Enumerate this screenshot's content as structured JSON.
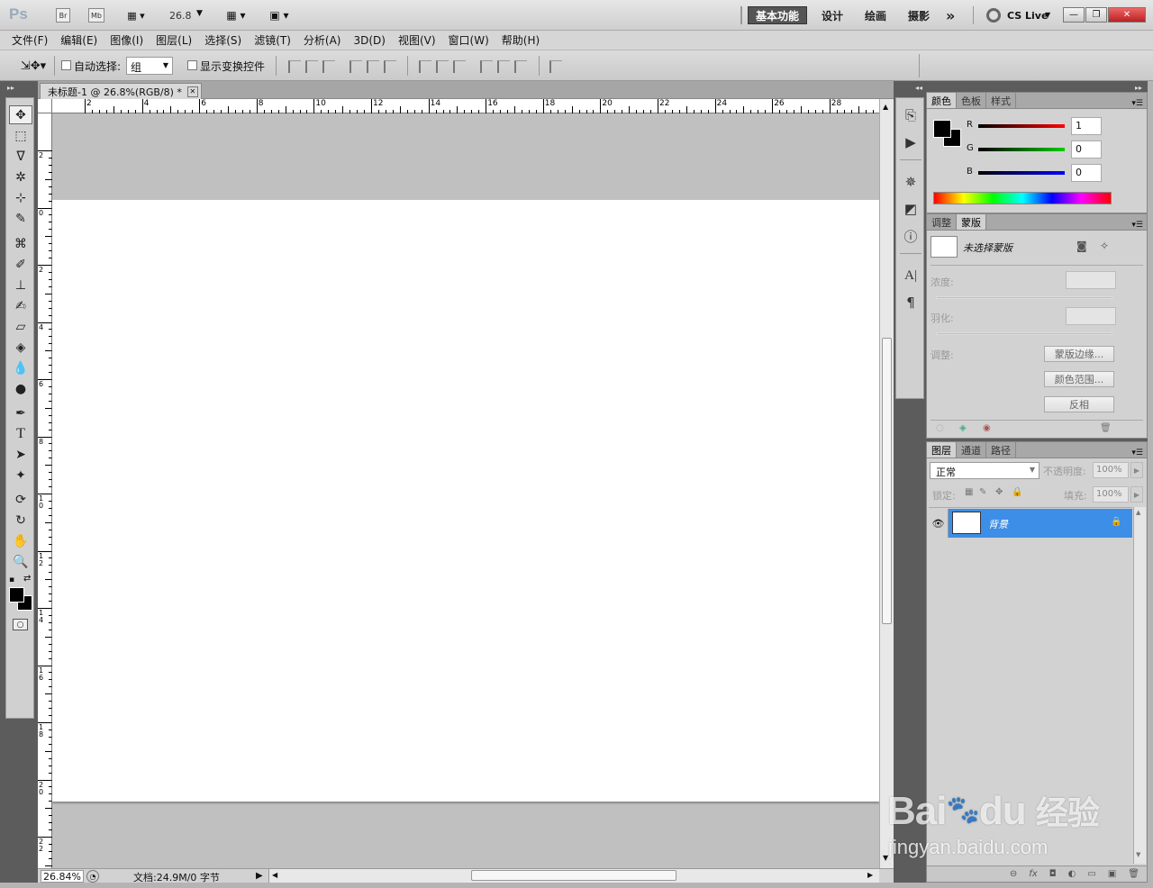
{
  "app": {
    "logo": "Ps",
    "bridge_label": "Br",
    "minibridge_label": "Mb",
    "zoom_value": "26.8",
    "workspaces": [
      "基本功能",
      "设计",
      "绘画",
      "摄影"
    ],
    "more": "»",
    "cs_live": "CS Live",
    "win_controls": [
      "—",
      "❐",
      "✕"
    ]
  },
  "menu": [
    "文件(F)",
    "编辑(E)",
    "图像(I)",
    "图层(L)",
    "选择(S)",
    "滤镜(T)",
    "分析(A)",
    "3D(D)",
    "视图(V)",
    "窗口(W)",
    "帮助(H)"
  ],
  "options": {
    "auto_select_label": "自动选择:",
    "auto_select_value": "组",
    "show_transform_label": "显示变换控件"
  },
  "document": {
    "tab_title": "未标题-1 @ 26.8%(RGB/8) *",
    "tab_close": "✕",
    "ruler_h_labels": [
      "2",
      "4",
      "6",
      "8",
      "10",
      "12",
      "14",
      "16",
      "18",
      "20",
      "22",
      "24",
      "26",
      "28"
    ],
    "ruler_v_labels": [
      "2",
      "0",
      "2",
      "4",
      "6",
      "8",
      "1\n0",
      "1\n2",
      "1\n4",
      "1\n6",
      "1\n8",
      "2\n0",
      "2\n2"
    ],
    "status_zoom": "26.84%",
    "status_doc": "文档:24.9M/0 字节"
  },
  "color_panel": {
    "tabs": [
      "颜色",
      "色板",
      "样式"
    ],
    "channels": [
      {
        "label": "R",
        "value": "1",
        "color": "#cc0000"
      },
      {
        "label": "G",
        "value": "0",
        "color": "#00aa00"
      },
      {
        "label": "B",
        "value": "0",
        "color": "#0000cc"
      }
    ]
  },
  "masks_panel": {
    "tabs": [
      "调整",
      "蒙版"
    ],
    "no_mask": "未选择蒙版",
    "density_label": "浓度:",
    "feather_label": "羽化:",
    "refine_label": "调整:",
    "buttons": [
      "蒙版边缘...",
      "颜色范围...",
      "反相"
    ]
  },
  "layers_panel": {
    "tabs": [
      "图层",
      "通道",
      "路径"
    ],
    "blend_mode": "正常",
    "opacity_label": "不透明度:",
    "opacity_value": "100%",
    "lock_label": "锁定:",
    "fill_label": "填充:",
    "fill_value": "100%",
    "layer_name": "背景",
    "footer_icons": [
      "⊖",
      "fx",
      "◘",
      "◐",
      "▭",
      "▣",
      "🗑"
    ]
  },
  "watermark": {
    "brand": "Bai",
    "brand2": "du",
    "cn": "经验",
    "url": "jingyan.baidu.com"
  }
}
